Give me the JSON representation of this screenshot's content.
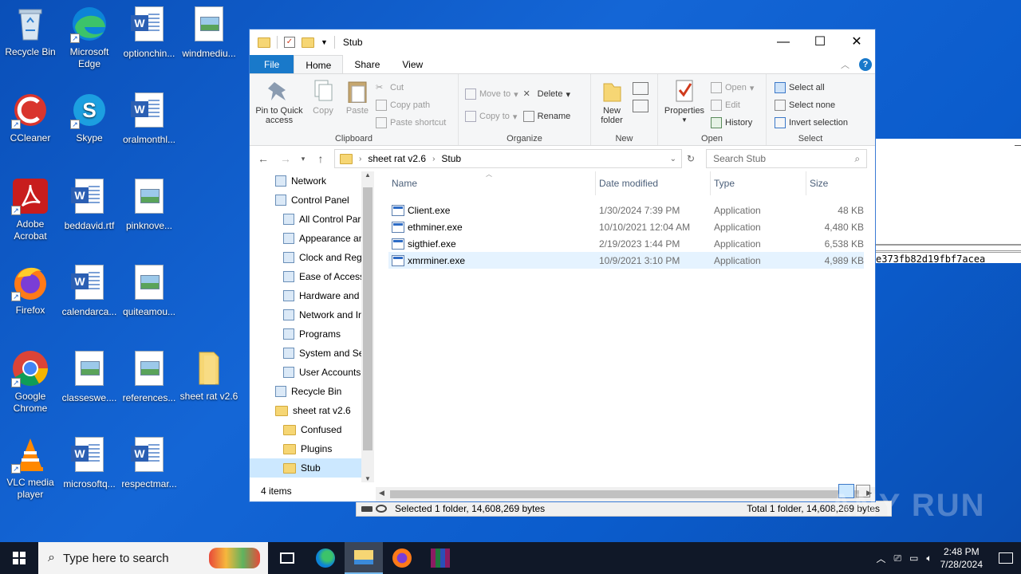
{
  "desktop": {
    "icons": [
      {
        "label": "Recycle Bin",
        "icon": "recycle-bin-icon"
      },
      {
        "label": "Microsoft Edge",
        "icon": "edge-icon"
      },
      {
        "label": "optionchin...",
        "icon": "word-doc-icon"
      },
      {
        "label": "windmediu...",
        "icon": "image-file-icon"
      },
      {
        "label": "CCleaner",
        "icon": "ccleaner-icon"
      },
      {
        "label": "Skype",
        "icon": "skype-icon"
      },
      {
        "label": "oralmonthl...",
        "icon": "word-doc-icon"
      },
      {
        "label": "Adobe Acrobat",
        "icon": "acrobat-icon"
      },
      {
        "label": "beddavid.rtf",
        "icon": "word-doc-icon"
      },
      {
        "label": "pinknove...",
        "icon": "image-file-icon"
      },
      {
        "label": "Firefox",
        "icon": "firefox-icon"
      },
      {
        "label": "calendarca...",
        "icon": "word-doc-icon"
      },
      {
        "label": "quiteamou...",
        "icon": "image-file-icon"
      },
      {
        "label": "Google Chrome",
        "icon": "chrome-icon"
      },
      {
        "label": "classeswe....",
        "icon": "image-file-icon"
      },
      {
        "label": "references...",
        "icon": "image-file-icon"
      },
      {
        "label": "sheet rat v2.6",
        "icon": "folder-icon"
      },
      {
        "label": "VLC media player",
        "icon": "vlc-icon"
      },
      {
        "label": "microsoftq...",
        "icon": "word-doc-icon"
      },
      {
        "label": "respectmar...",
        "icon": "word-doc-icon"
      }
    ]
  },
  "explorer": {
    "title": "Stub",
    "tabs": {
      "file": "File",
      "home": "Home",
      "share": "Share",
      "view": "View"
    },
    "ribbon": {
      "clipboard": {
        "name": "Clipboard",
        "pin": "Pin to Quick access",
        "copy": "Copy",
        "paste": "Paste",
        "cut": "Cut",
        "copy_path": "Copy path",
        "paste_shortcut": "Paste shortcut"
      },
      "organize": {
        "name": "Organize",
        "move_to": "Move to",
        "copy_to": "Copy to",
        "delete": "Delete",
        "rename": "Rename"
      },
      "new": {
        "name": "New",
        "new_folder": "New folder"
      },
      "open": {
        "name": "Open",
        "properties": "Properties",
        "open": "Open",
        "edit": "Edit",
        "history": "History"
      },
      "select": {
        "name": "Select",
        "select_all": "Select all",
        "select_none": "Select none",
        "invert": "Invert selection"
      }
    },
    "address": {
      "crumb1": "sheet rat v2.6",
      "crumb2": "Stub"
    },
    "search_placeholder": "Search Stub",
    "nav": [
      {
        "label": "Network",
        "indent": 1
      },
      {
        "label": "Control Panel",
        "indent": 1
      },
      {
        "label": "All Control Par",
        "indent": 2
      },
      {
        "label": "Appearance an",
        "indent": 2
      },
      {
        "label": "Clock and Regi",
        "indent": 2
      },
      {
        "label": "Ease of Access",
        "indent": 2
      },
      {
        "label": "Hardware and",
        "indent": 2
      },
      {
        "label": "Network and Ir",
        "indent": 2
      },
      {
        "label": "Programs",
        "indent": 2
      },
      {
        "label": "System and Sec",
        "indent": 2
      },
      {
        "label": "User Accounts",
        "indent": 2
      },
      {
        "label": "Recycle Bin",
        "indent": 1
      },
      {
        "label": "sheet rat v2.6",
        "indent": 1
      },
      {
        "label": "Confused",
        "indent": 2
      },
      {
        "label": "Plugins",
        "indent": 2
      },
      {
        "label": "Stub",
        "indent": 2,
        "selected": true
      }
    ],
    "columns": {
      "name": "Name",
      "date": "Date modified",
      "type": "Type",
      "size": "Size"
    },
    "files": [
      {
        "name": "Client.exe",
        "date": "1/30/2024 7:39 PM",
        "type": "Application",
        "size": "48 KB"
      },
      {
        "name": "ethminer.exe",
        "date": "10/10/2021 12:04 AM",
        "type": "Application",
        "size": "4,480 KB"
      },
      {
        "name": "sigthief.exe",
        "date": "2/19/2023 1:44 PM",
        "type": "Application",
        "size": "6,538 KB"
      },
      {
        "name": "xmrminer.exe",
        "date": "10/9/2021 3:10 PM",
        "type": "Application",
        "size": "4,989 KB",
        "selected": true
      }
    ],
    "status_items": "4 items"
  },
  "background_window": {
    "hash_text": "e373fb82d19fbf7acea",
    "status_left": "Selected 1 folder, 14,608,269 bytes",
    "status_right": "Total 1 folder, 14,608,269 bytes"
  },
  "taskbar": {
    "search_placeholder": "Type here to search",
    "time": "2:48 PM",
    "date": "7/28/2024"
  },
  "watermark": "ANY RUN"
}
